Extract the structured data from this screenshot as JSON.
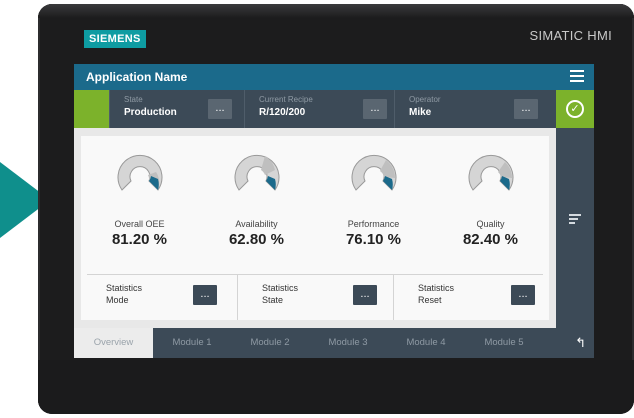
{
  "device": {
    "brand_logo": "SIEMENS",
    "model": "SIMATIC HMI"
  },
  "app": {
    "title": "Application Name"
  },
  "status": {
    "state_label": "State",
    "state_value": "Production",
    "recipe_label": "Current Recipe",
    "recipe_value": "R/120/200",
    "operator_label": "Operator",
    "operator_value": "Mike",
    "more": "..."
  },
  "kpis": [
    {
      "label": "Overall OEE",
      "value": "81.20 %"
    },
    {
      "label": "Availability",
      "value": "62.80 %"
    },
    {
      "label": "Performance",
      "value": "76.10 %"
    },
    {
      "label": "Quality",
      "value": "82.40 %"
    }
  ],
  "stats": [
    {
      "line1": "Statistics",
      "line2": "Mode"
    },
    {
      "line1": "Statistics",
      "line2": "State"
    },
    {
      "line1": "Statistics",
      "line2": "Reset"
    }
  ],
  "tabs": [
    "Overview",
    "Module 1",
    "Module 2",
    "Module 3",
    "Module 4",
    "Module 5"
  ],
  "colors": {
    "accent_green": "#7cb22b",
    "header_blue": "#1b6a8b",
    "dark_panel": "#3c4a57",
    "gauge_highlight": "#1b6a8b",
    "siemens_teal": "#0e9ca2"
  },
  "icons": {
    "menu": "hamburger-icon",
    "confirm": "check-circle-icon",
    "sort": "sort-lines-icon",
    "back": "back-arrow-icon"
  }
}
